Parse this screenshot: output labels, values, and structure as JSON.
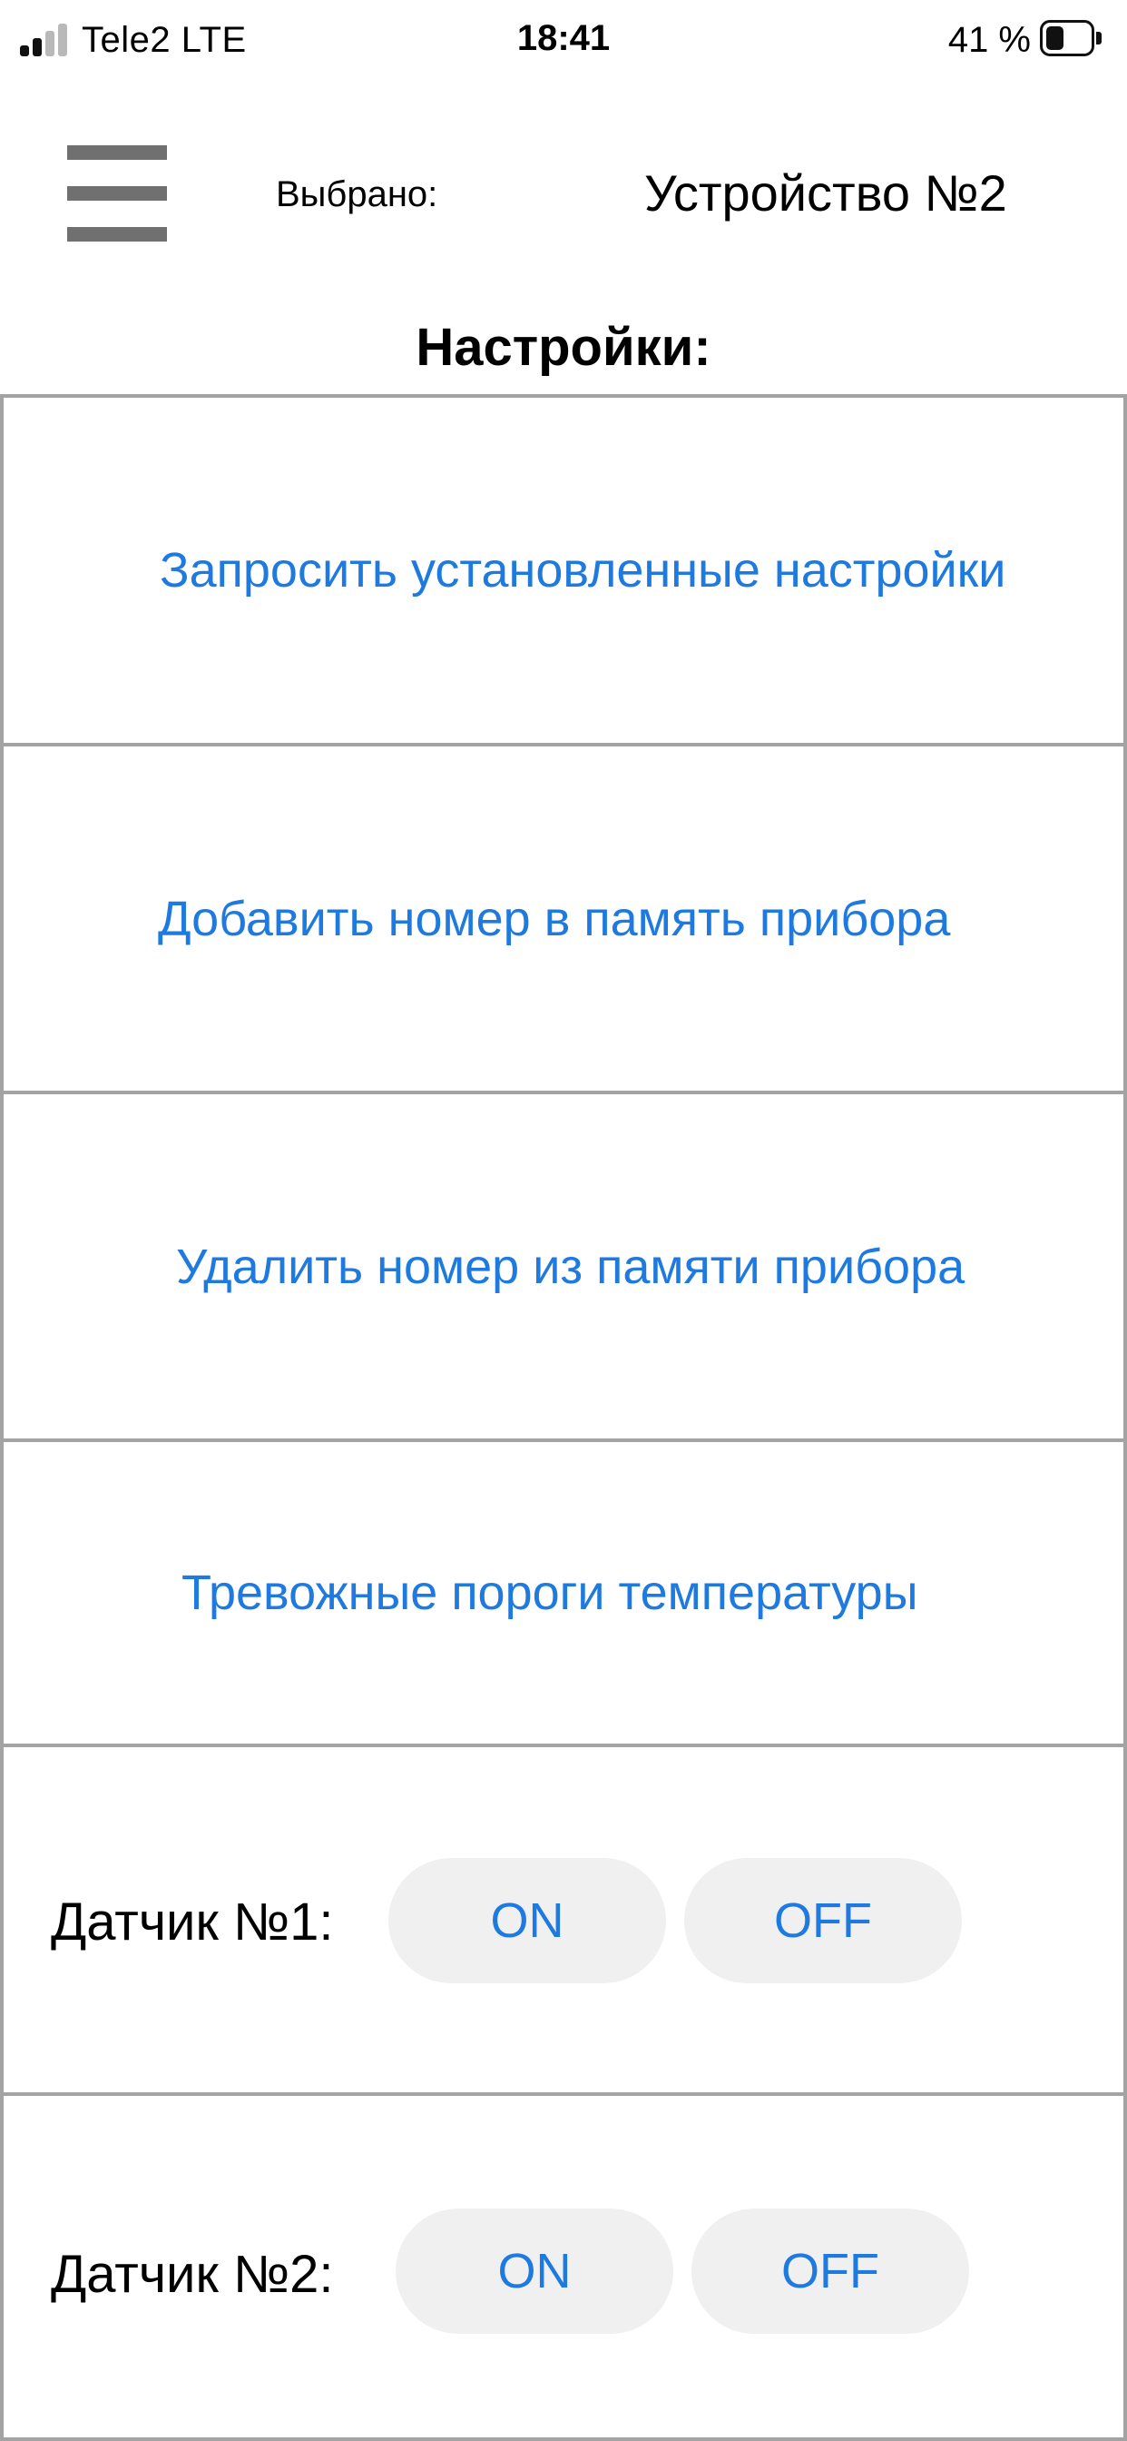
{
  "status_bar": {
    "carrier": "Tele2  LTE",
    "time": "18:41",
    "battery_percent": "41 %",
    "battery_level": 0.41,
    "signal_bars_filled": 2,
    "signal_bars_total": 4
  },
  "header": {
    "menu_icon": "hamburger-menu-icon",
    "selected_label": "Выбрано:",
    "device_name": "Устройство №2"
  },
  "page_title": "Настройки:",
  "actions": [
    {
      "label": "Запросить установленные настройки"
    },
    {
      "label": "Добавить номер в память прибора"
    },
    {
      "label": "Удалить номер из памяти прибора"
    },
    {
      "label": "Тревожные пороги температуры"
    }
  ],
  "sensors": [
    {
      "label": "Датчик №1:",
      "on_label": "ON",
      "off_label": "OFF"
    },
    {
      "label": "Датчик №2:",
      "on_label": "ON",
      "off_label": "OFF"
    }
  ],
  "colors": {
    "accent": "#1f7ae0",
    "divider": "#a3a3a3",
    "pill_background": "#f0f0f0",
    "menu_icon": "#707070"
  }
}
